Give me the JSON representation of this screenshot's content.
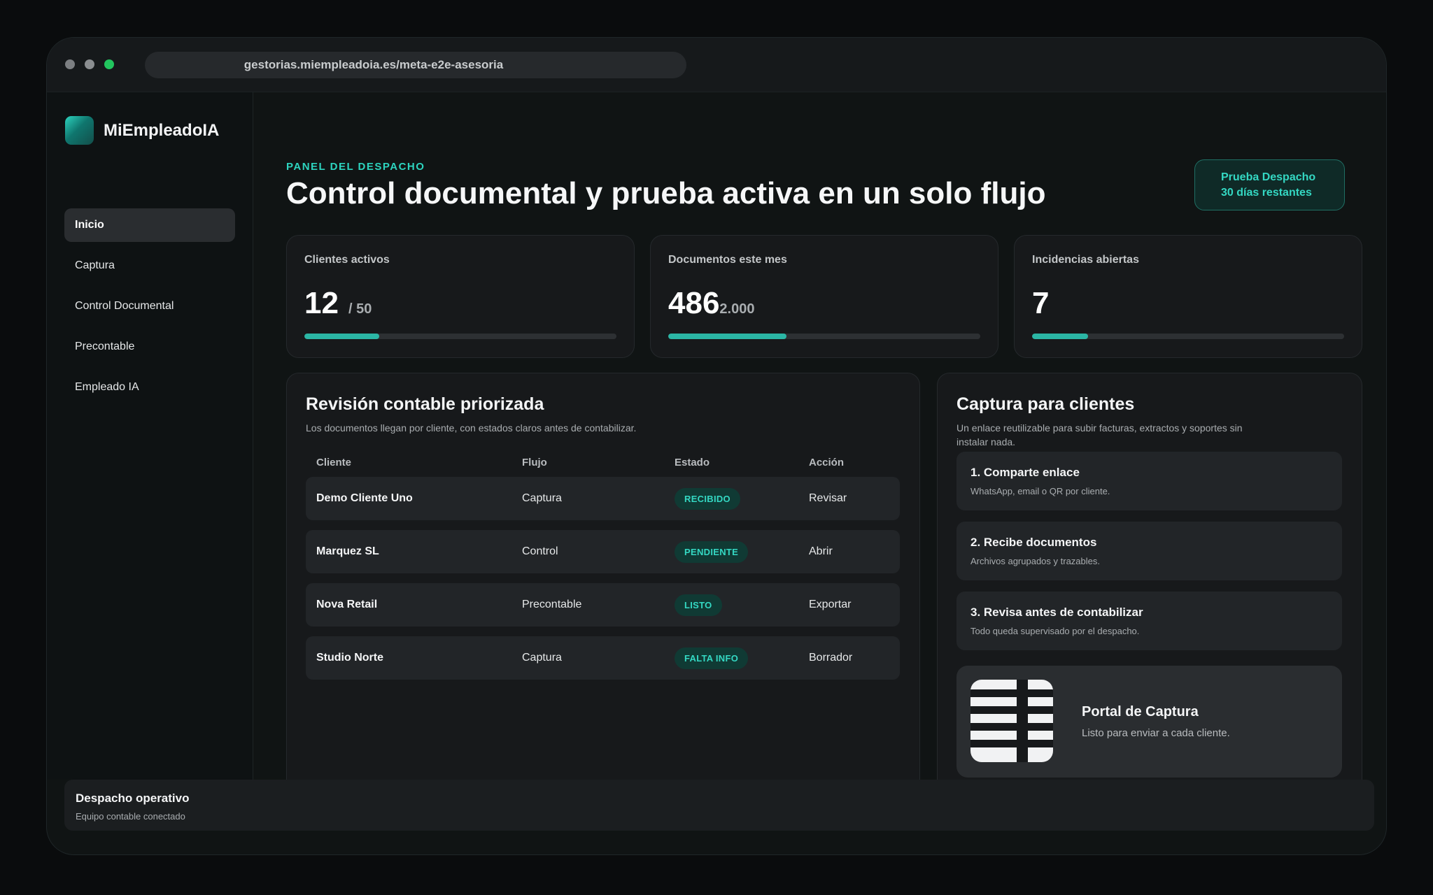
{
  "browser": {
    "url": "gestorias.miempleadoia.es/meta-e2e-asesoria"
  },
  "sidebar": {
    "brand": "MiEmpleadoIA",
    "items": [
      {
        "label": "Inicio",
        "active": true
      },
      {
        "label": "Captura",
        "active": false
      },
      {
        "label": "Control Documental",
        "active": false
      },
      {
        "label": "Precontable",
        "active": false
      },
      {
        "label": "Empleado IA",
        "active": false
      }
    ]
  },
  "header": {
    "eyebrow": "PANEL DEL DESPACHO",
    "title": "Control documental y prueba activa en un solo flujo",
    "trial_line1": "Prueba Despacho",
    "trial_line2": "30 días restantes"
  },
  "kpis": [
    {
      "label": "Clientes activos",
      "value": "12",
      "suffix": "/ 50",
      "progress": 0.24
    },
    {
      "label": "Documentos este mes",
      "value": "486",
      "suffix": "2.000",
      "progress": 0.38
    },
    {
      "label": "Incidencias abiertas",
      "value": "7",
      "suffix": "",
      "progress": 0.18
    }
  ],
  "review": {
    "title": "Revisión contable priorizada",
    "subtitle": "Los documentos llegan por cliente, con estados claros antes de contabilizar.",
    "columns": [
      "Cliente",
      "Flujo",
      "Estado",
      "Acción"
    ],
    "rows": [
      {
        "client": "Demo Cliente Uno",
        "flow": "Captura",
        "status": "RECIBIDO",
        "action": "Revisar"
      },
      {
        "client": "Marquez SL",
        "flow": "Control",
        "status": "PENDIENTE",
        "action": "Abrir"
      },
      {
        "client": "Nova Retail",
        "flow": "Precontable",
        "status": "LISTO",
        "action": "Exportar"
      },
      {
        "client": "Studio Norte",
        "flow": "Captura",
        "status": "FALTA INFO",
        "action": "Borrador"
      }
    ]
  },
  "capture": {
    "title": "Captura para clientes",
    "subtitle_line1": "Un enlace reutilizable para subir facturas, extractos y soportes sin",
    "subtitle_line2": "instalar nada.",
    "steps": [
      {
        "title": "1. Comparte enlace",
        "desc": "WhatsApp, email o QR por cliente."
      },
      {
        "title": "2. Recibe documentos",
        "desc": "Archivos agrupados y trazables."
      },
      {
        "title": "3. Revisa antes de contabilizar",
        "desc": "Todo queda supervisado por el despacho."
      }
    ],
    "portal_title": "Portal de Captura",
    "portal_desc": "Listo para enviar a cada cliente."
  },
  "footer": {
    "title": "Despacho operativo",
    "subtitle": "Equipo contable conectado"
  },
  "colors": {
    "accent": "#2dd4bf",
    "progress": "#2bb6a5",
    "pill_bg": "#103a34",
    "window_dot_green": "#22c55e"
  }
}
